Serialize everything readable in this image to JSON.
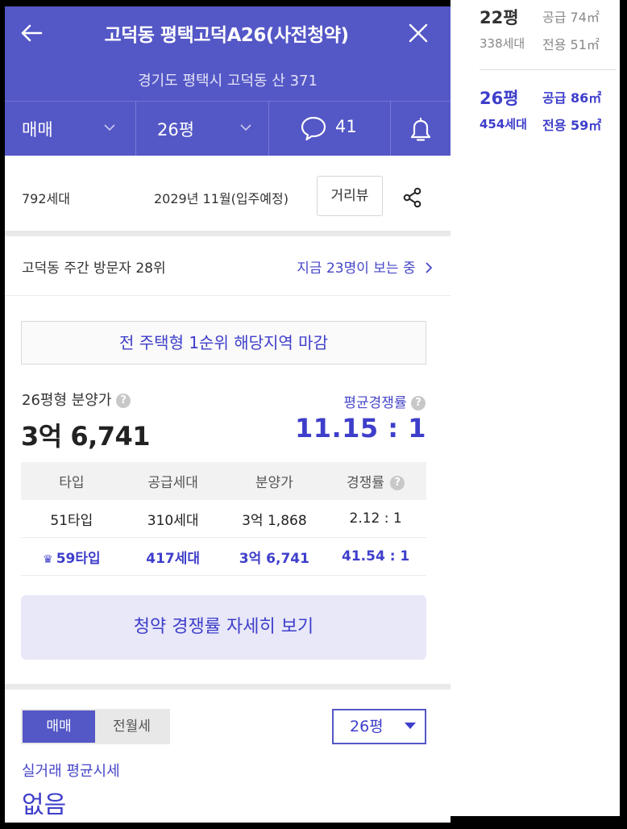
{
  "header": {
    "title": "고덕동 평택고덕A26(사전청약)",
    "address": "경기도 평택시 고덕동 산 371",
    "filters": {
      "trade_type": "매매",
      "size": "26평",
      "comments_count": "41"
    }
  },
  "info": {
    "households": "792세대",
    "move_in": "2029년 11월(입주예정)",
    "street_view_label": "거리뷰"
  },
  "visitors": {
    "rank": "고덕동 주간 방문자 28위",
    "viewing_now": "지금 23명이 보는 중"
  },
  "notice": "전 주택형 1순위 해당지역 마감",
  "price": {
    "label": "26평형 분양가",
    "value": "3억 6,741",
    "competition_label": "평균경쟁률",
    "competition_value": "11.15 : 1"
  },
  "table": {
    "headers": [
      "타입",
      "공급세대",
      "분양가",
      "경쟁률"
    ],
    "rows": [
      [
        "51타입",
        "310세대",
        "3억 1,868",
        "2.12 : 1"
      ],
      [
        "59타입",
        "417세대",
        "3억 6,741",
        "41.54 : 1"
      ]
    ]
  },
  "detail_button": "청약 경쟁률 자세히 보기",
  "market": {
    "tabs": [
      "매매",
      "전월세"
    ],
    "active_tab": "매매",
    "size_select": "26평",
    "avg_label": "실거래 평균시세",
    "avg_value": "없음"
  },
  "side_panel": {
    "rows": [
      {
        "pyeong": "22평",
        "supply": "공급 74㎡",
        "units": "338세대",
        "exclusive": "전용 51㎡"
      },
      {
        "pyeong": "26평",
        "supply": "공급 86㎡",
        "units": "454세대",
        "exclusive": "전용 59㎡"
      }
    ]
  },
  "colors": {
    "brand": "#5457c6",
    "accent_text": "#3e3ecb",
    "light_accent": "#e8e8f9"
  }
}
